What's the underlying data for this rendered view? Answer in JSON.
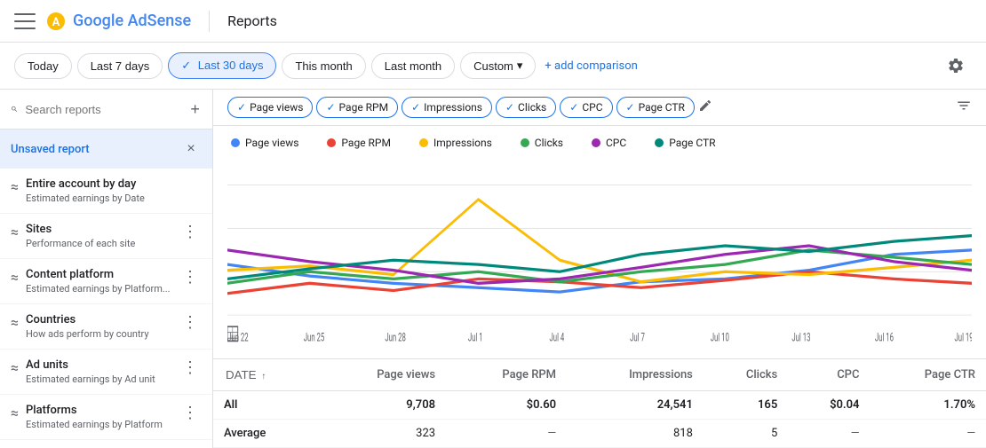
{
  "header": {
    "menu_label": "menu",
    "logo_text": "Google AdSense",
    "divider": true,
    "title": "Reports"
  },
  "filter_bar": {
    "buttons": [
      {
        "id": "today",
        "label": "Today",
        "active": false
      },
      {
        "id": "last7",
        "label": "Last 7 days",
        "active": false
      },
      {
        "id": "last30",
        "label": "Last 30 days",
        "active": true,
        "check": true
      },
      {
        "id": "thismonth",
        "label": "This month",
        "active": false
      },
      {
        "id": "lastmonth",
        "label": "Last month",
        "active": false
      },
      {
        "id": "custom",
        "label": "Custom",
        "active": false,
        "dropdown": true
      }
    ],
    "add_comparison_label": "+ add comparison",
    "settings_icon": "settings"
  },
  "sidebar": {
    "search_placeholder": "Search reports",
    "unsaved_report": {
      "label": "Unsaved report",
      "close_icon": "×"
    },
    "nav_items": [
      {
        "id": "entire-account",
        "icon": "≈",
        "title": "Entire account by day",
        "subtitle": "Estimated earnings by Date"
      },
      {
        "id": "sites",
        "icon": "≈",
        "title": "Sites",
        "subtitle": "Performance of each site"
      },
      {
        "id": "content-platform",
        "icon": "≈",
        "title": "Content platform",
        "subtitle": "Estimated earnings by Platform..."
      },
      {
        "id": "countries",
        "icon": "≈",
        "title": "Countries",
        "subtitle": "How ads perform by country"
      },
      {
        "id": "ad-units",
        "icon": "≈",
        "title": "Ad units",
        "subtitle": "Estimated earnings by Ad unit"
      },
      {
        "id": "platforms",
        "icon": "≈",
        "title": "Platforms",
        "subtitle": "Estimated earnings by Platform"
      }
    ]
  },
  "metrics": {
    "chips": [
      {
        "id": "page-views",
        "label": "Page views",
        "active": true,
        "color": "#4285f4"
      },
      {
        "id": "page-rpm",
        "label": "Page RPM",
        "active": true,
        "color": "#ea4335"
      },
      {
        "id": "impressions",
        "label": "Impressions",
        "active": true,
        "color": "#fbbc04"
      },
      {
        "id": "clicks",
        "label": "Clicks",
        "active": true,
        "color": "#34a853"
      },
      {
        "id": "cpc",
        "label": "CPC",
        "active": true,
        "color": "#9c27b0"
      },
      {
        "id": "page-ctr",
        "label": "Page CTR",
        "active": true,
        "color": "#00897b"
      }
    ]
  },
  "chart": {
    "legend": [
      {
        "label": "Page views",
        "color": "#4285f4"
      },
      {
        "label": "Page RPM",
        "color": "#ea4335"
      },
      {
        "label": "Impressions",
        "color": "#fbbc04"
      },
      {
        "label": "Clicks",
        "color": "#34a853"
      },
      {
        "label": "CPC",
        "color": "#9c27b0"
      },
      {
        "label": "Page CTR",
        "color": "#00897b"
      }
    ],
    "x_labels": [
      "Jun 22",
      "Jun 25",
      "Jun 28",
      "Jul 1",
      "Jul 4",
      "Jul 7",
      "Jul 10",
      "Jul 13",
      "Jul 16",
      "Jul 19"
    ],
    "lines": {
      "page_views": [
        55,
        48,
        45,
        42,
        40,
        44,
        46,
        50,
        58,
        60
      ],
      "page_rpm": [
        30,
        35,
        32,
        38,
        36,
        33,
        37,
        40,
        38,
        35
      ],
      "impressions": [
        50,
        52,
        48,
        80,
        55,
        45,
        50,
        48,
        52,
        55
      ],
      "clicks": [
        35,
        40,
        38,
        42,
        36,
        40,
        44,
        50,
        48,
        45
      ],
      "cpc": [
        60,
        55,
        50,
        45,
        48,
        52,
        58,
        62,
        55,
        50
      ],
      "page_ctr": [
        40,
        45,
        50,
        48,
        44,
        55,
        60,
        58,
        62,
        65
      ]
    }
  },
  "table": {
    "columns": [
      {
        "id": "date",
        "label": "DATE",
        "sort": true
      },
      {
        "id": "page_views",
        "label": "Page views"
      },
      {
        "id": "page_rpm",
        "label": "Page RPM"
      },
      {
        "id": "impressions",
        "label": "Impressions"
      },
      {
        "id": "clicks",
        "label": "Clicks"
      },
      {
        "id": "cpc",
        "label": "CPC"
      },
      {
        "id": "page_ctr",
        "label": "Page CTR"
      }
    ],
    "rows": [
      {
        "date": "All",
        "page_views": "9,708",
        "page_rpm": "$0.60",
        "impressions": "24,541",
        "clicks": "165",
        "cpc": "$0.04",
        "page_ctr": "1.70%",
        "bold": true
      },
      {
        "date": "Average",
        "page_views": "323",
        "page_rpm": "—",
        "impressions": "818",
        "clicks": "5",
        "cpc": "—",
        "page_ctr": "—",
        "italic": true
      }
    ]
  }
}
